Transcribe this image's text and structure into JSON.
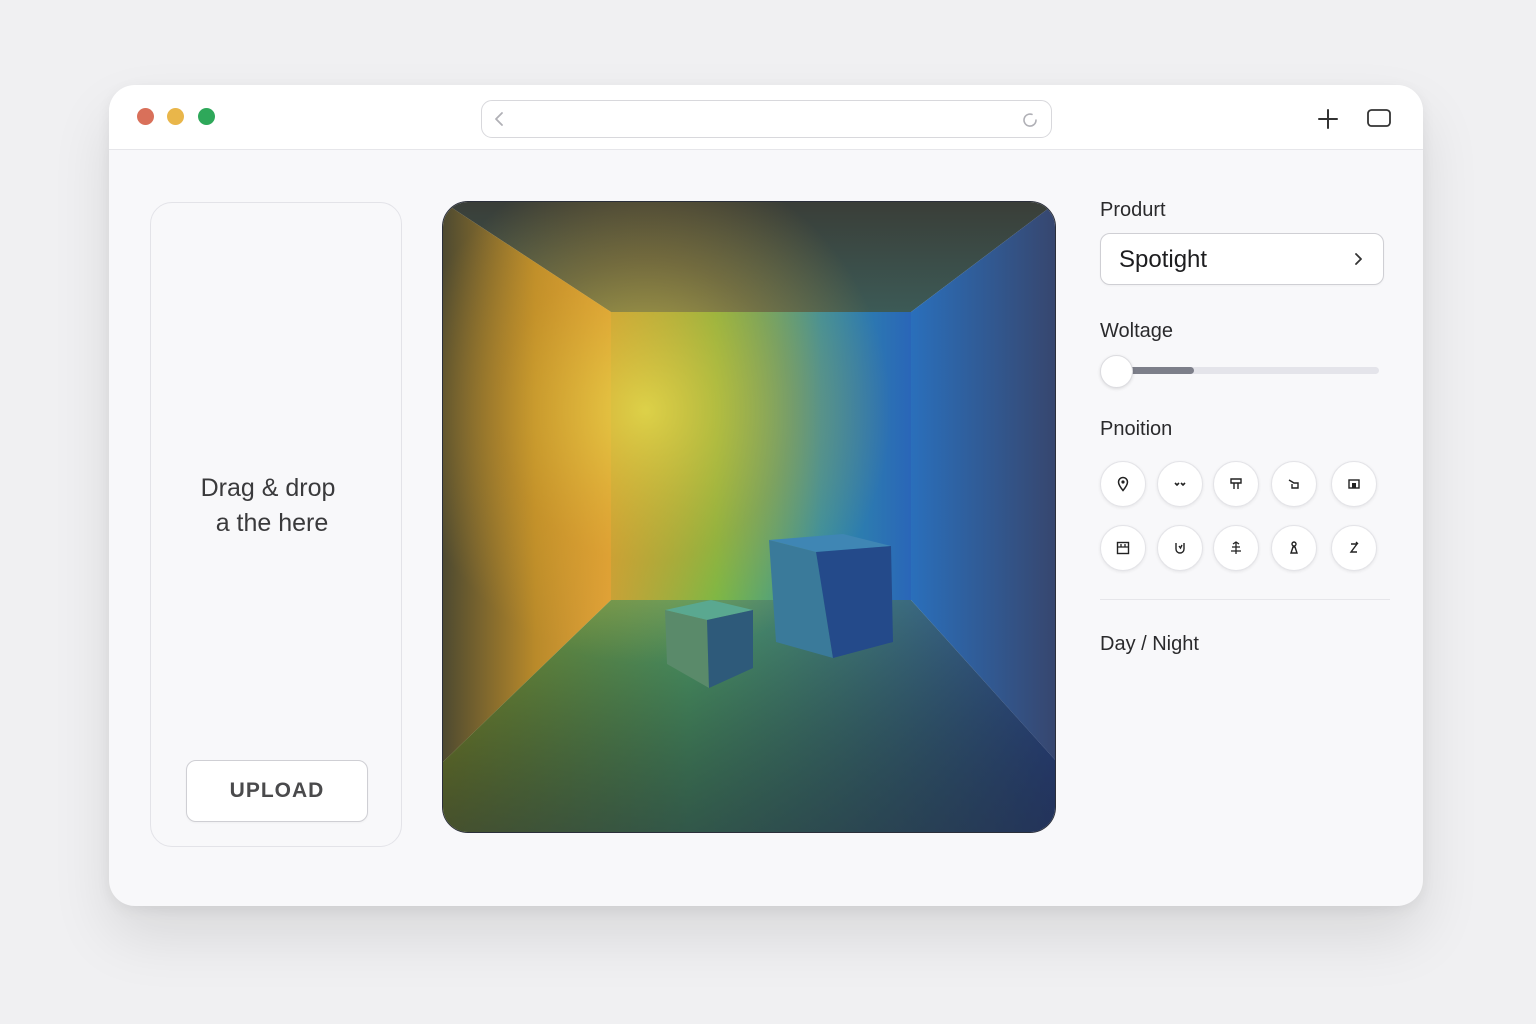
{
  "window": {
    "controls": [
      "close",
      "minimize",
      "maximize"
    ],
    "url": "",
    "toolbar_icons": [
      "back-icon",
      "reload-icon",
      "plus-icon",
      "tabs-icon"
    ]
  },
  "dropzone": {
    "line1": "Drag & drop",
    "line2": "a the here",
    "upload_label": "UPLOAD"
  },
  "preview": {
    "description_icon": "rendered-room-preview"
  },
  "sidebar": {
    "product_label": "Produrt",
    "product_value": "Spotight",
    "voltage_label": "Woltage",
    "voltage_level": 0.3,
    "position_label": "Pnoition",
    "position_icons": [
      "pin-icon",
      "double-dot-icon",
      "lamp-icon",
      "tilt-icon",
      "box-icon",
      "grid-icon",
      "shield-icon",
      "tree-icon",
      "figure-icon",
      "hook-icon"
    ],
    "daynight_label": "Day / Night"
  },
  "colors": {
    "accent": "#7d7f8a",
    "red": "#d9705a",
    "yellow": "#e9b64a",
    "green": "#2ea85a"
  }
}
